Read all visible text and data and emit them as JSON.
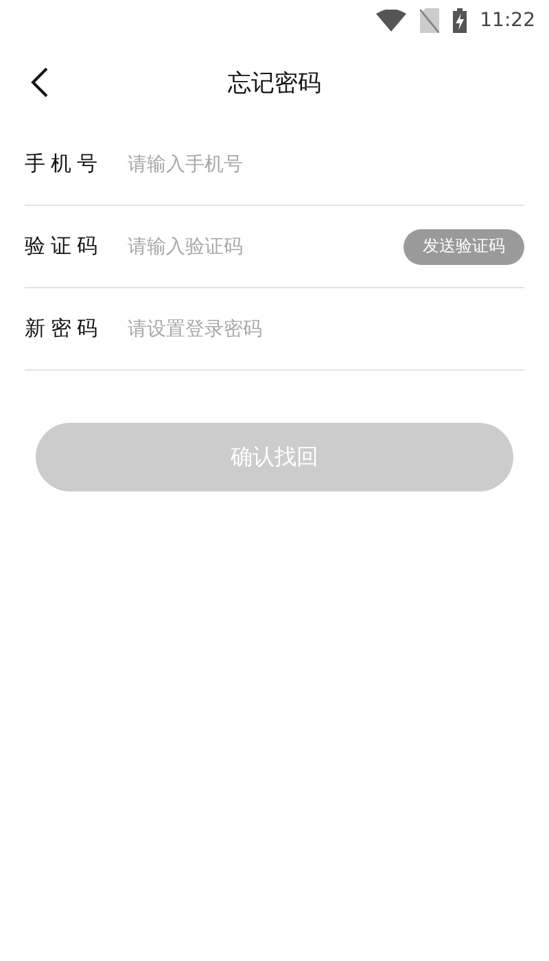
{
  "status_bar": {
    "time": "11:22"
  },
  "header": {
    "title": "忘记密码"
  },
  "fields": [
    {
      "label": "手机号",
      "placeholder": "请输入手机号"
    },
    {
      "label": "验证码",
      "placeholder": "请输入验证码",
      "button": {
        "label": "发送验证码",
        "disabled": true
      }
    },
    {
      "label": "新密码",
      "placeholder": "请设置登录密码"
    }
  ],
  "submit": {
    "label": "确认找回",
    "disabled": true
  }
}
